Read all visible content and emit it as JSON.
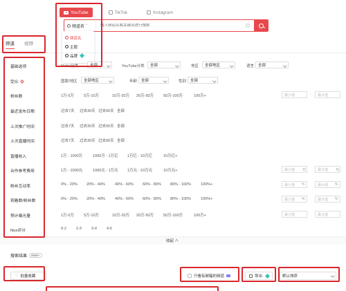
{
  "platforms": [
    {
      "label": "YouTube",
      "icon": "youtube-icon",
      "active": true
    },
    {
      "label": "TikTok",
      "icon": "tiktok-icon",
      "active": false
    },
    {
      "label": "Instagram",
      "icon": "instagram-icon",
      "active": false
    }
  ],
  "search": {
    "type_label": "频道名",
    "placeholder": "输入频道名或关键词进行搜索",
    "help": "?"
  },
  "dropdown": {
    "items": [
      {
        "label": "频道名",
        "selected": true
      },
      {
        "label": "主题",
        "selected": false
      },
      {
        "label": "品牌",
        "selected": false
      }
    ]
  },
  "tabs": {
    "channel": "频道",
    "video": "视频"
  },
  "filters": {
    "basic": {
      "label": "基础选项",
      "fields": [
        {
          "label": "Niche分类",
          "value": "全部"
        },
        {
          "label": "YouTube分类",
          "value": "全部"
        },
        {
          "label": "地区",
          "value": "全部地区"
        },
        {
          "label": "语言",
          "value": "全部"
        }
      ]
    },
    "audience": {
      "label": "受众",
      "fields": [
        {
          "label": "国家/地区",
          "value": "全部地区"
        },
        {
          "label": "年龄",
          "value": "全部"
        },
        {
          "label": "性别",
          "value": "全部"
        }
      ]
    },
    "subscribers": {
      "label": "粉丝数",
      "options": [
        "1万-5万",
        "5万-10万",
        "10万-20万",
        "20万-50万",
        "50万-100万",
        "100万+"
      ],
      "min": "最小值",
      "max": "最大值",
      "dash": "-"
    },
    "last_post": {
      "label": "最近发布日期",
      "options": [
        "过去7天",
        "过去30天",
        "过去90天",
        "全部"
      ]
    },
    "last_promo": {
      "label": "上次推广时间",
      "options": [
        "过去7天",
        "过去30天",
        "过去90天",
        "全部"
      ]
    },
    "last_live": {
      "label": "上次直播时间",
      "options": [
        "过去7天",
        "过去30天",
        "过去90天",
        "全部"
      ]
    },
    "live_income": {
      "label": "直播收入",
      "options": [
        "1万 - 1000万",
        "1000万 - 1万亿",
        "1万亿 - 10万亿",
        "10万亿+"
      ]
    },
    "coop_cost": {
      "label": "合作参考费用",
      "options": [
        "1万 - 1000元",
        "1000元 - 1万元",
        "1万元 - 10万元",
        "10万元+"
      ],
      "min": "最小值",
      "max": "最大值",
      "unit": "元"
    },
    "engagement": {
      "label": "粉丝互动率",
      "options": [
        "0% - 20%",
        "20% - 40%",
        "40% - 60%",
        "60% - 80%",
        "80% - 100%",
        "100%+"
      ],
      "min": "最小值",
      "max": "最大值",
      "unit": "%"
    },
    "view_ratio": {
      "label": "观看数/粉丝数",
      "options": [
        "0% - 20%",
        "20% - 40%",
        "40% - 60%",
        "60% - 80%",
        "80% - 100%",
        "100%+"
      ],
      "min": "最小值",
      "max": "最大值",
      "unit": "%"
    },
    "est_views": {
      "label": "预计曝光量",
      "options": [
        "1万-5万",
        "5万-10万",
        "10万-20万",
        "20万-50万",
        "50万-100万",
        "100万+"
      ],
      "min": "最小值",
      "max": "最大值"
    },
    "nox_score": {
      "label": "Nox评分",
      "options": [
        "0-2",
        "2-3",
        "3-4",
        "4-5"
      ]
    }
  },
  "collapse_label": "收起 ∧",
  "results": {
    "label": "搜索结果",
    "count": "9999+",
    "batch_collect": "批量收藏",
    "contact_only": "只看有邮箱的频道",
    "export": "导出",
    "sort": "默认排序"
  },
  "colors": {
    "accent": "#e8484c",
    "highlight": "#d9262b",
    "gem": "#3ac3b8",
    "crown": "#8a7cf6"
  }
}
